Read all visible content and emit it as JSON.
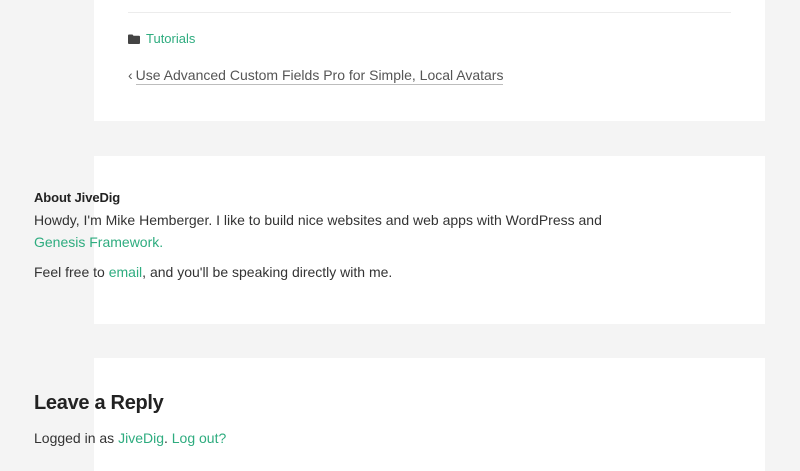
{
  "post_footer": {
    "category_icon": "folder-icon",
    "category_label": "Tutorials",
    "prev_arrow": "‹",
    "prev_post_label": "Use Advanced Custom Fields Pro for Simple, Local Avatars"
  },
  "about": {
    "title": "About JiveDig",
    "text_before": "Howdy, I'm Mike Hemberger. I like to build nice websites and web apps with WordPress and ",
    "genesis_link": "Genesis Framework.",
    "line2_before": "Feel free to ",
    "email_link": "email",
    "line2_after": ", and you'll be speaking directly with me."
  },
  "reply": {
    "title": "Leave a Reply",
    "logged_in_prefix": "Logged in as ",
    "user_link": "JiveDig",
    "separator": ". ",
    "logout_link": "Log out?"
  },
  "colors": {
    "link": "#2eac7f",
    "background": "#f4f4f4",
    "card": "#ffffff"
  }
}
